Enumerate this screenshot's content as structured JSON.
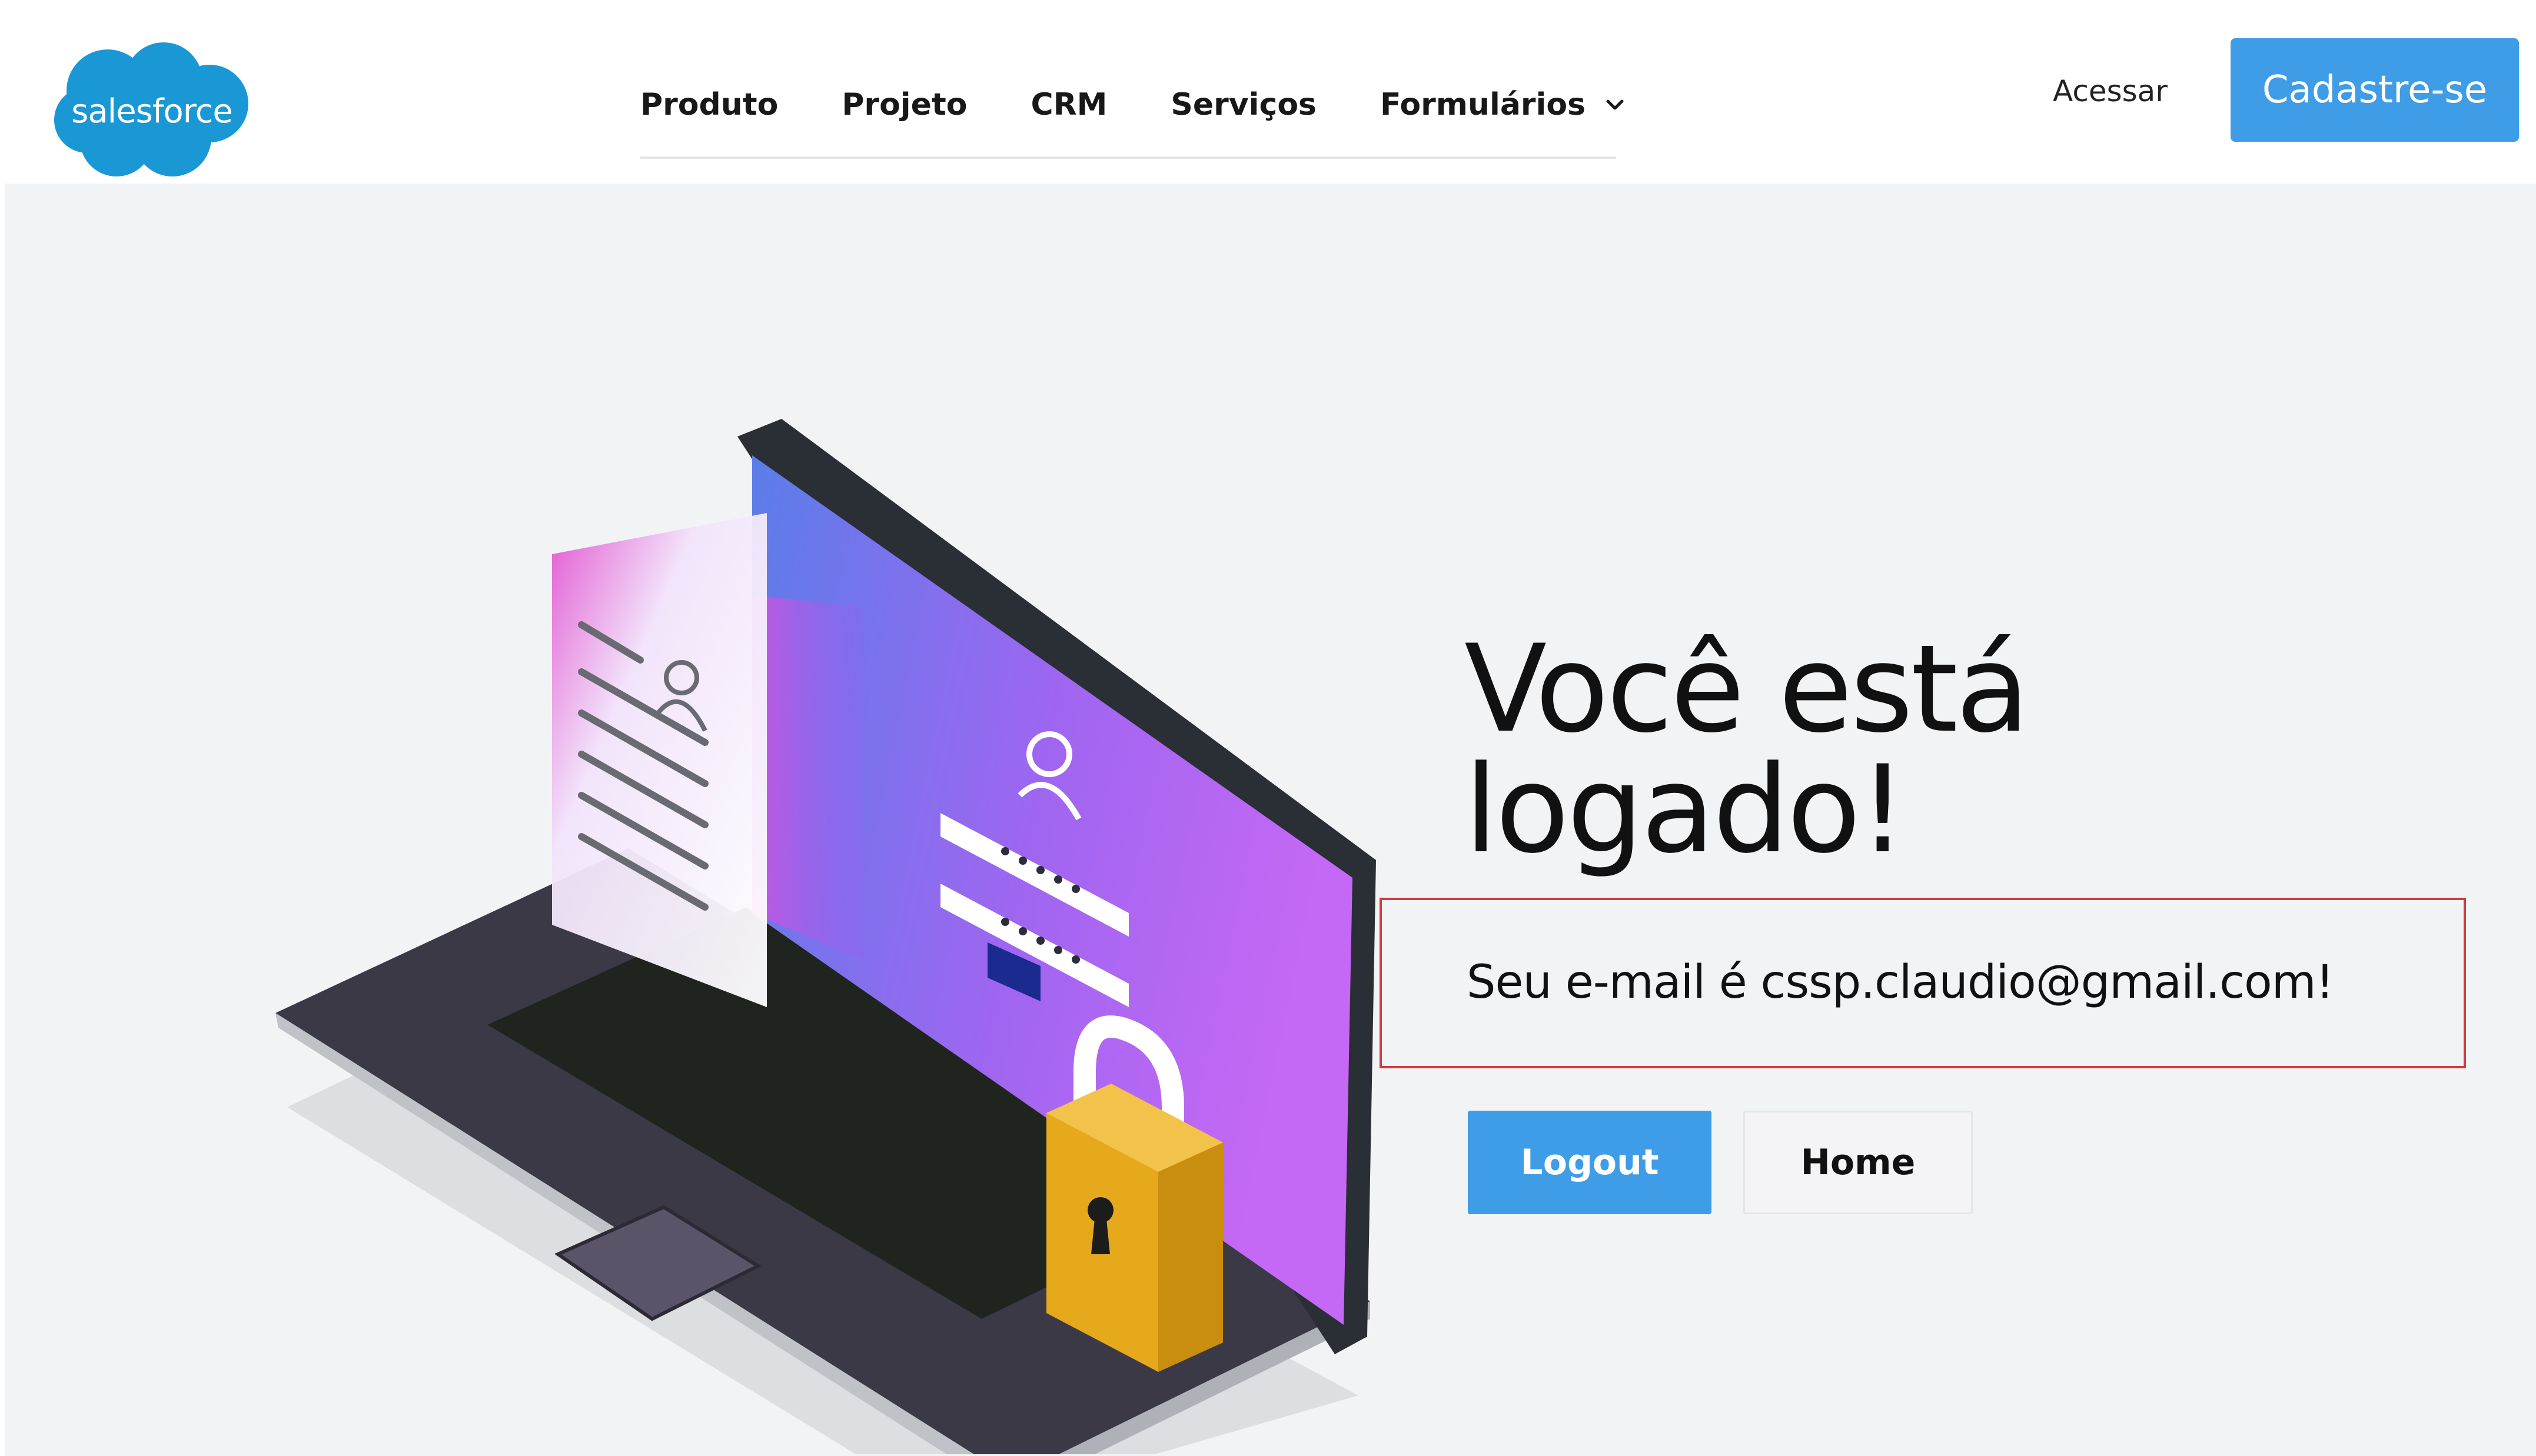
{
  "header": {
    "logo_text": "salesforce",
    "nav": [
      {
        "label": "Produto"
      },
      {
        "label": "Projeto"
      },
      {
        "label": "CRM"
      },
      {
        "label": "Serviços"
      },
      {
        "label": "Formulários",
        "icon": "chevron-down-icon"
      }
    ],
    "login_link": "Acessar",
    "signup_button": "Cadastre-se"
  },
  "main": {
    "title_line1": "Você está",
    "title_line2": "logado!",
    "email_message": "Seu e-mail é cssp.claudio@gmail.com!",
    "logout_button": "Logout",
    "home_button": "Home",
    "illustration": "laptop-login-lock-illustration"
  },
  "colors": {
    "brand_blue": "#3e9de6",
    "logo_blue": "#1a98d5",
    "highlight_border": "#d33a3f",
    "page_background": "#f2f3f5"
  }
}
